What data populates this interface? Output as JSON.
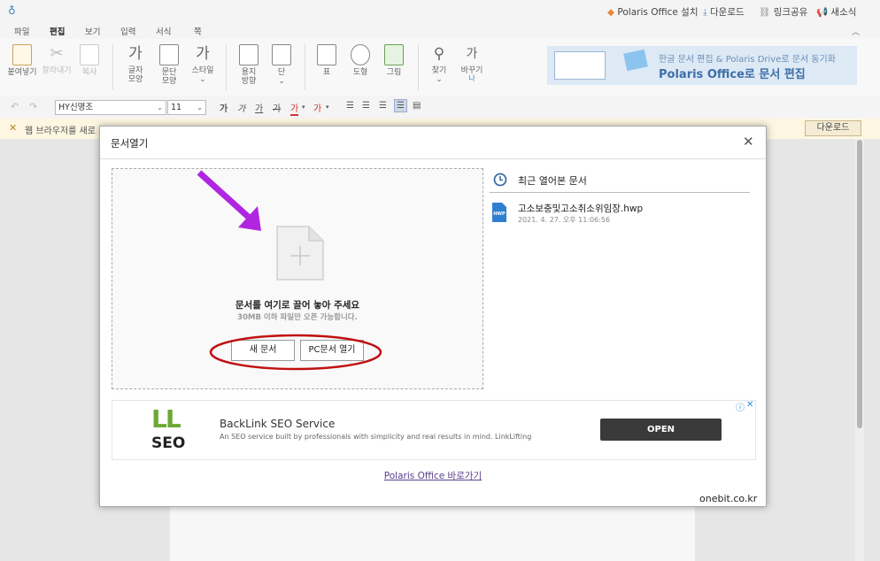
{
  "topbar": {
    "install_label": "Polaris Office 설치",
    "download_label": "다운로드",
    "share_label": "링크공유",
    "news_label": "새소식"
  },
  "menu": {
    "items": [
      "파일",
      "편집",
      "보기",
      "입력",
      "서식",
      "쪽"
    ],
    "active": "편집"
  },
  "ribbon": {
    "paste": "붙여넣기",
    "cut": "잘라내기",
    "copy": "복사",
    "char_shape": [
      "글자",
      "모양"
    ],
    "para_shape": [
      "문단",
      "모양"
    ],
    "style": "스타일",
    "page_dir": [
      "용지",
      "방향"
    ],
    "column": "단",
    "table": "표",
    "shape": "도형",
    "picture": "그림",
    "find": "찾기",
    "replace": "바꾸기",
    "banner_line1": "한글 문서 편집 & Polaris Drive로 문서 동기화",
    "banner_line2": "Polaris Office로 문서 편집"
  },
  "format": {
    "font": "HY신명조",
    "size": "11"
  },
  "notice": {
    "text": "웹 브라우저를 새로 고",
    "download_button": "다운로드"
  },
  "dialog": {
    "title": "문서열기",
    "drop_title": "문서를 여기로 끌어 놓아 주세요",
    "drop_sub": "30MB 이하 파일만 오픈 가능합니다.",
    "new_doc": "새 문서",
    "open_pc": "PC문서 열기",
    "recent_title": "최근 열어본 문서",
    "recent_files": [
      {
        "name": "고소보충및고소취소위임장.hwp",
        "date": "2021. 4. 27. 오후 11:06:56",
        "badge": "HWP"
      }
    ],
    "ad": {
      "logo_top": "LL",
      "logo_bottom": "SEO",
      "title": "BackLink SEO Service",
      "desc": "An SEO service built by professionals with simplicity and real results in mind. LinkLifting",
      "button": "OPEN"
    },
    "footer_link": "Polaris Office 바로가기"
  },
  "watermark": "onebit.co.kr",
  "colors": {
    "accent": "#3b82c4",
    "annotation": "#c01010",
    "arrow": "#b026e0",
    "ad_button": "#3a3a3a"
  }
}
